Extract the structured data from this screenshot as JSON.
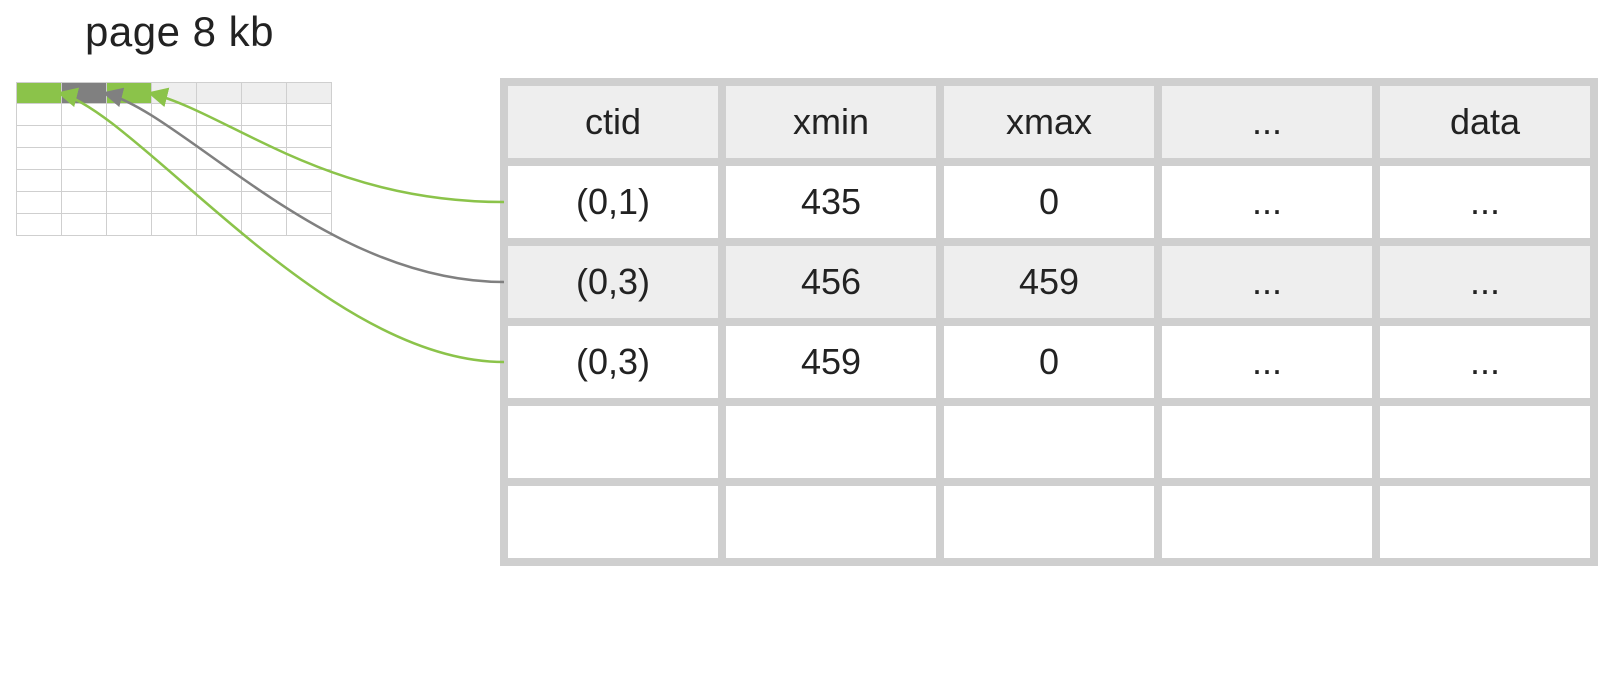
{
  "page_label": "page 8 kb",
  "page_grid": {
    "cols": 7,
    "rows": 7,
    "header_slots": [
      "green",
      "grey",
      "green",
      "empty",
      "empty",
      "empty",
      "empty"
    ]
  },
  "table": {
    "headers": [
      "ctid",
      "xmin",
      "xmax",
      "...",
      "data"
    ],
    "rows": [
      {
        "ctid": "(0,1)",
        "xmin": "435",
        "xmax": "0",
        "c4": "...",
        "data": "...",
        "state": "live"
      },
      {
        "ctid": "(0,3)",
        "xmin": "456",
        "xmax": "459",
        "c4": "...",
        "data": "...",
        "state": "dead"
      },
      {
        "ctid": "(0,3)",
        "xmin": "459",
        "xmax": "0",
        "c4": "...",
        "data": "...",
        "state": "live"
      }
    ],
    "empty_rows": 2
  },
  "arrows": [
    {
      "from_row": 0,
      "to_slot": 2,
      "color": "green"
    },
    {
      "from_row": 1,
      "to_slot": 1,
      "color": "grey"
    },
    {
      "from_row": 2,
      "to_slot": 0,
      "color": "green"
    }
  ],
  "colors": {
    "green": "#8bc34a",
    "grey": "#808080"
  }
}
